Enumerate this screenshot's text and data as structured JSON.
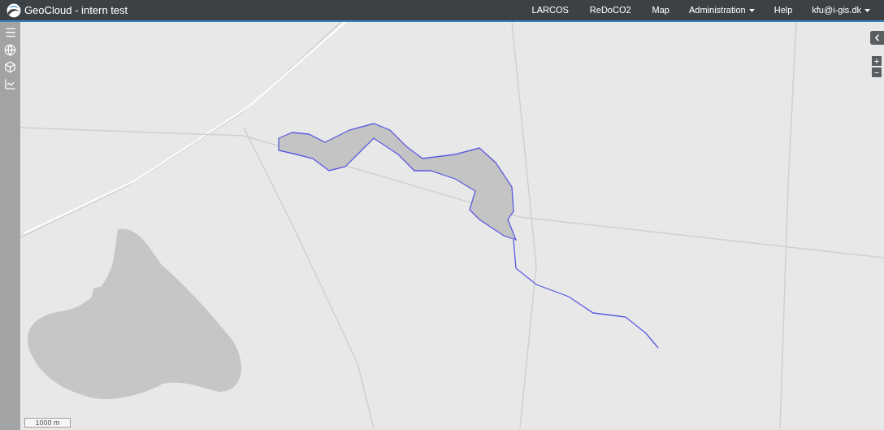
{
  "header": {
    "title": "GeoCloud - intern test",
    "nav": [
      {
        "label": "LARCOS",
        "kind": "link"
      },
      {
        "label": "ReDoCO2",
        "kind": "link"
      },
      {
        "label": "Map",
        "kind": "link"
      },
      {
        "label": "Administration",
        "kind": "dropdown"
      },
      {
        "label": "Help",
        "kind": "link"
      },
      {
        "label": "kfu@i-gis.dk",
        "kind": "dropdown"
      }
    ]
  },
  "map": {
    "zoom_in": "+",
    "zoom_out": "−",
    "scale": "1000 m"
  }
}
